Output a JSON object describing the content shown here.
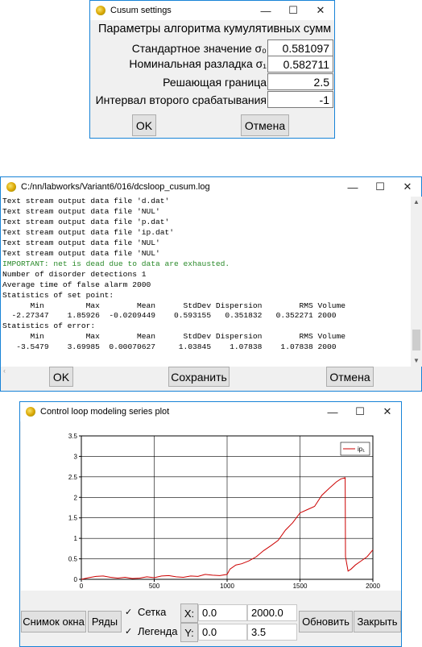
{
  "cusum": {
    "title": "Cusum settings",
    "heading": "Параметры алгоритма кумулятивных сумм",
    "std_label": "Стандартное значение σ₀",
    "std_value": "0.581097",
    "nom_label": "Номинальная разладка σ₁",
    "nom_value": "0.582711",
    "bound_label": "Решающая граница",
    "bound_value": "2.5",
    "interval_label": "Интервал второго срабатывания",
    "interval_value": "-1",
    "ok": "OK",
    "cancel": "Отмена"
  },
  "log": {
    "title": "C:/nn/labworks/Variant6/016/dcsloop_cusum.log",
    "lines": [
      "Text stream output data file 'd.dat'",
      "Text stream output data file 'NUL'",
      "Text stream output data file 'p.dat'",
      "Text stream output data file 'ip.dat'",
      "Text stream output data file 'NUL'",
      "Text stream output data file 'NUL'",
      "IMPORTANT: net is dead due to data are exhausted.",
      "Number of disorder detections 1",
      "Average time of false alarm 2000",
      "Statistics of set point:",
      "      Min         Max        Mean      StdDev Dispersion        RMS Volume",
      "  -2.27347    1.85926  -0.0209449    0.593155   0.351832   0.352271 2000",
      "Statistics of error:",
      "      Min         Max        Mean      StdDev Dispersion        RMS Volume",
      "   -3.5479    3.69985  0.00070627     1.03845    1.07838    1.07838 2000"
    ],
    "ok": "OK",
    "save": "Сохранить",
    "cancel": "Отмена"
  },
  "plot": {
    "title": "Control loop modeling series plot",
    "snapshot": "Снимок окна",
    "series_btn": "Ряды",
    "grid_label": "Сетка",
    "legend_label": "Легенда",
    "grid_checked": true,
    "legend_checked": true,
    "x_label": "X:",
    "y_label": "Y:",
    "x_min": "0.0",
    "x_max": "2000.0",
    "y_min": "0.0",
    "y_max": "3.5",
    "refresh": "Обновить",
    "close": "Закрыть",
    "series_color": "#cc0000"
  },
  "chart_data": {
    "type": "line",
    "xlim": [
      0,
      2000
    ],
    "ylim": [
      0,
      3.5
    ],
    "x_ticks": [
      "0",
      "500",
      "1000",
      "1500",
      "2000"
    ],
    "y_ticks": [
      "0",
      "0.5",
      "1",
      "1.5",
      "2",
      "2.5",
      "3",
      "3.5"
    ],
    "grid": true,
    "legend": "top-right",
    "series": [
      {
        "name": "ip₁",
        "color": "#cc0000",
        "x": [
          0,
          50,
          100,
          150,
          200,
          250,
          300,
          350,
          400,
          450,
          500,
          550,
          600,
          650,
          700,
          750,
          800,
          850,
          900,
          950,
          1000,
          1020,
          1060,
          1100,
          1150,
          1200,
          1250,
          1300,
          1350,
          1400,
          1450,
          1500,
          1550,
          1600,
          1650,
          1700,
          1750,
          1780,
          1810,
          1812,
          1830,
          1850,
          1880,
          1920,
          1960,
          2000
        ],
        "y": [
          0.0,
          0.04,
          0.07,
          0.08,
          0.05,
          0.03,
          0.05,
          0.02,
          0.03,
          0.06,
          0.04,
          0.08,
          0.09,
          0.06,
          0.05,
          0.08,
          0.07,
          0.12,
          0.1,
          0.09,
          0.12,
          0.25,
          0.35,
          0.38,
          0.45,
          0.55,
          0.7,
          0.82,
          0.95,
          1.2,
          1.38,
          1.62,
          1.7,
          1.78,
          2.05,
          2.22,
          2.38,
          2.45,
          2.48,
          0.55,
          0.2,
          0.25,
          0.35,
          0.45,
          0.55,
          0.72
        ]
      }
    ]
  }
}
